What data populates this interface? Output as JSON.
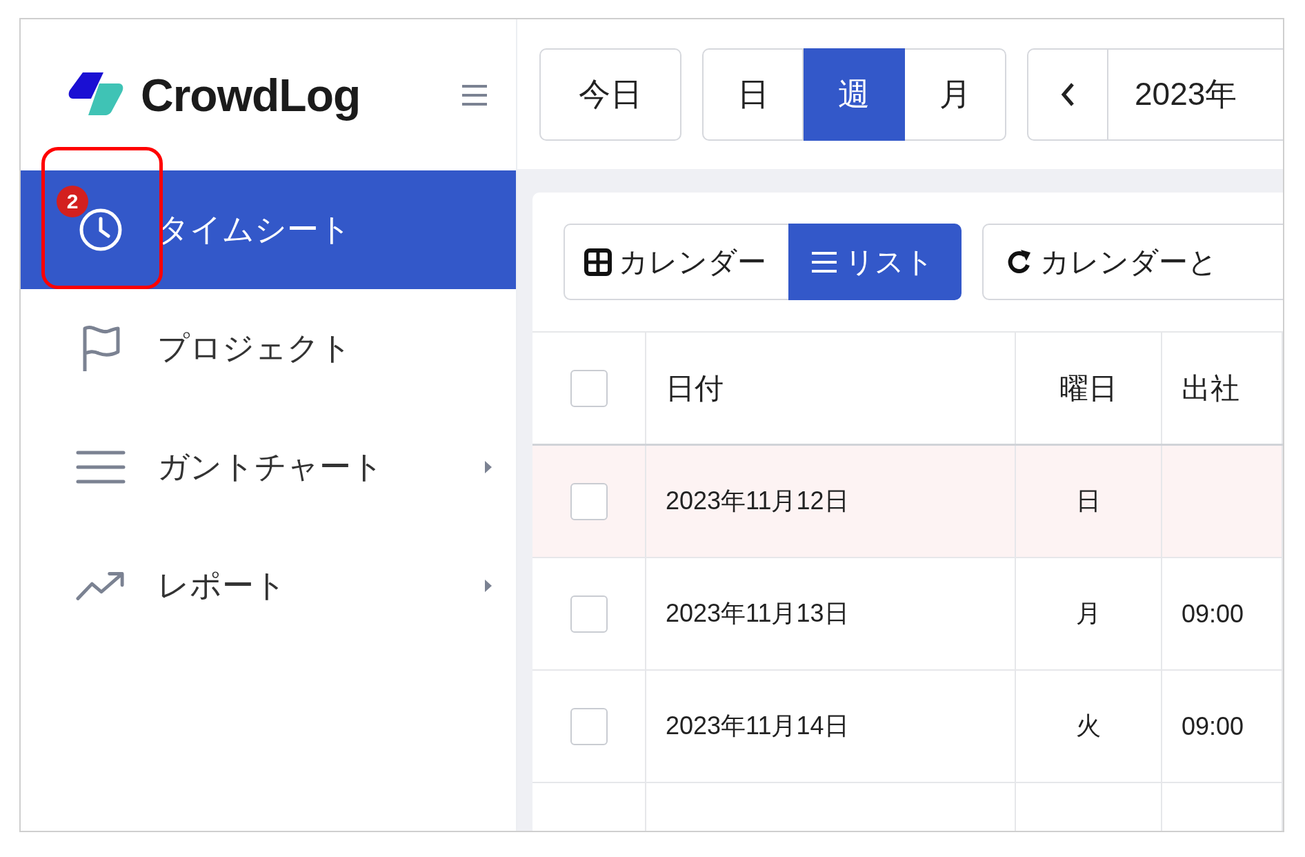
{
  "app": {
    "logo": "CrowdLog"
  },
  "sidebar": {
    "items": [
      {
        "label": "タイムシート",
        "kind": "clock",
        "selected": true,
        "expandable": false,
        "badge": "2",
        "highlighted": true
      },
      {
        "label": "プロジェクト",
        "kind": "flag",
        "selected": false,
        "expandable": false,
        "highlighted": false
      },
      {
        "label": "ガントチャート",
        "kind": "lines",
        "selected": false,
        "expandable": true,
        "highlighted": false
      },
      {
        "label": "レポート",
        "kind": "trend",
        "selected": false,
        "expandable": true,
        "highlighted": false
      }
    ]
  },
  "topbar": {
    "today_button": "今日",
    "view_modes": [
      {
        "label": "日",
        "selected": false
      },
      {
        "label": "週",
        "selected": true
      },
      {
        "label": "月",
        "selected": false
      }
    ],
    "date_range": "2023年"
  },
  "toolbar": {
    "view_toggle": [
      {
        "label": "カレンダー",
        "kind": "calendar",
        "selected": false
      },
      {
        "label": "リスト",
        "kind": "list",
        "selected": true
      }
    ],
    "sync_button": "カレンダーと"
  },
  "table": {
    "select_all": {
      "checked": false
    },
    "columns": [
      "日付",
      "曜日",
      "出社"
    ],
    "rows": [
      {
        "date": "2023年11月12日",
        "weekday": "日",
        "start": "",
        "holiday": true,
        "checked": false
      },
      {
        "date": "2023年11月13日",
        "weekday": "月",
        "start": "09:00",
        "holiday": false,
        "checked": false
      },
      {
        "date": "2023年11月14日",
        "weekday": "火",
        "start": "09:00",
        "holiday": false,
        "checked": false
      }
    ]
  }
}
